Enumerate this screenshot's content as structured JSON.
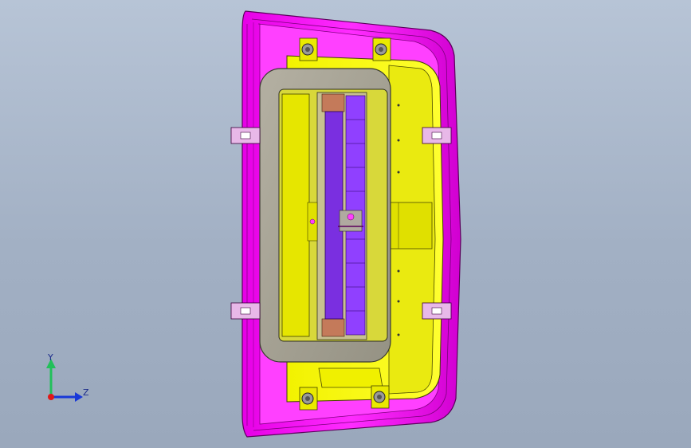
{
  "viewport": {
    "background_top": "#b7c4d6",
    "background_bottom": "#9aa8bc"
  },
  "model": {
    "outer_housing_color": "#ff00ff",
    "inner_housing_color": "#ffff00",
    "frame_color": "#a7a394",
    "slider_color": "#8a2be2",
    "pad_color": "#c47a5a",
    "fastener_icon": "screw-head-icon",
    "clip_icon": "clip-icon"
  },
  "triad": {
    "y_label": "Y",
    "z_label": "Z",
    "y_color": "#22c05a",
    "z_color": "#1838d8",
    "x_color": "#e01818"
  }
}
